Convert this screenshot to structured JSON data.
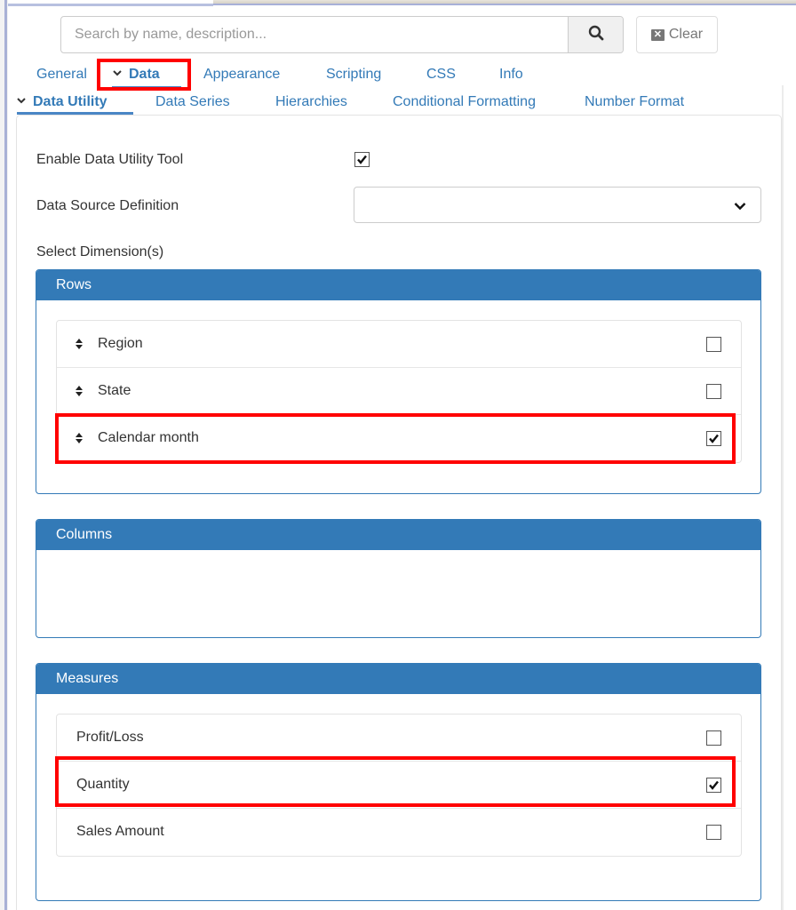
{
  "search": {
    "placeholder": "Search by name, description...",
    "value": "",
    "search_icon": "magnifier-icon",
    "clear_label": "Clear",
    "clear_icon": "close-box-icon"
  },
  "main_tabs": [
    {
      "label": "General",
      "active": false
    },
    {
      "label": "Data",
      "active": true,
      "icon": "chevron-down-icon"
    },
    {
      "label": "Appearance",
      "active": false
    },
    {
      "label": "Scripting",
      "active": false
    },
    {
      "label": "CSS",
      "active": false
    },
    {
      "label": "Info",
      "active": false
    }
  ],
  "sub_tabs": [
    {
      "label": "Data Utility",
      "active": true,
      "icon": "chevron-down-icon"
    },
    {
      "label": "Data Series",
      "active": false
    },
    {
      "label": "Hierarchies",
      "active": false
    },
    {
      "label": "Conditional Formatting",
      "active": false
    },
    {
      "label": "Number Format",
      "active": false
    }
  ],
  "form": {
    "enable_label": "Enable Data Utility Tool",
    "enable_checked": true,
    "source_label": "Data Source Definition",
    "source_value": "",
    "dimensions_label": "Select Dimension(s)"
  },
  "panels": {
    "rows": {
      "title": "Rows",
      "items": [
        {
          "label": "Region",
          "checked": false
        },
        {
          "label": "State",
          "checked": false
        },
        {
          "label": "Calendar month",
          "checked": true,
          "highlighted": true
        }
      ]
    },
    "columns": {
      "title": "Columns",
      "items": []
    },
    "measures": {
      "title": "Measures",
      "items": [
        {
          "label": "Profit/Loss",
          "checked": false
        },
        {
          "label": "Quantity",
          "checked": true,
          "highlighted": true
        },
        {
          "label": "Sales Amount",
          "checked": false
        }
      ]
    }
  },
  "colors": {
    "accent": "#337ab7",
    "highlight": "#ff0000",
    "text": "#333333"
  }
}
